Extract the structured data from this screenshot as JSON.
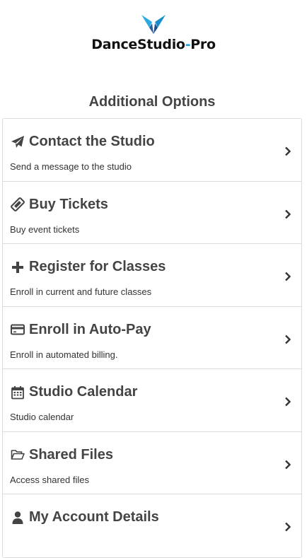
{
  "header": {
    "logo_name": "DanceStudio",
    "logo_dash": "-",
    "logo_suffix": "Pro"
  },
  "section_title": "Additional Options",
  "menu": [
    {
      "icon": "paper-plane-icon",
      "title": "Contact the Studio",
      "description": "Send a message to the studio"
    },
    {
      "icon": "ticket-icon",
      "title": "Buy Tickets",
      "description": "Buy event tickets"
    },
    {
      "icon": "plus-icon",
      "title": "Register for Classes",
      "description": "Enroll in current and future classes"
    },
    {
      "icon": "credit-card-icon",
      "title": "Enroll in Auto-Pay",
      "description": "Enroll in automated billing."
    },
    {
      "icon": "calendar-icon",
      "title": "Studio Calendar",
      "description": "Studio calendar"
    },
    {
      "icon": "folder-open-icon",
      "title": "Shared Files",
      "description": "Access shared files"
    },
    {
      "icon": "user-icon",
      "title": "My Account Details",
      "description": ""
    }
  ],
  "colors": {
    "brand_blue": "#1fa3dc",
    "text_dark": "#444444",
    "border": "#dcdcdc"
  }
}
